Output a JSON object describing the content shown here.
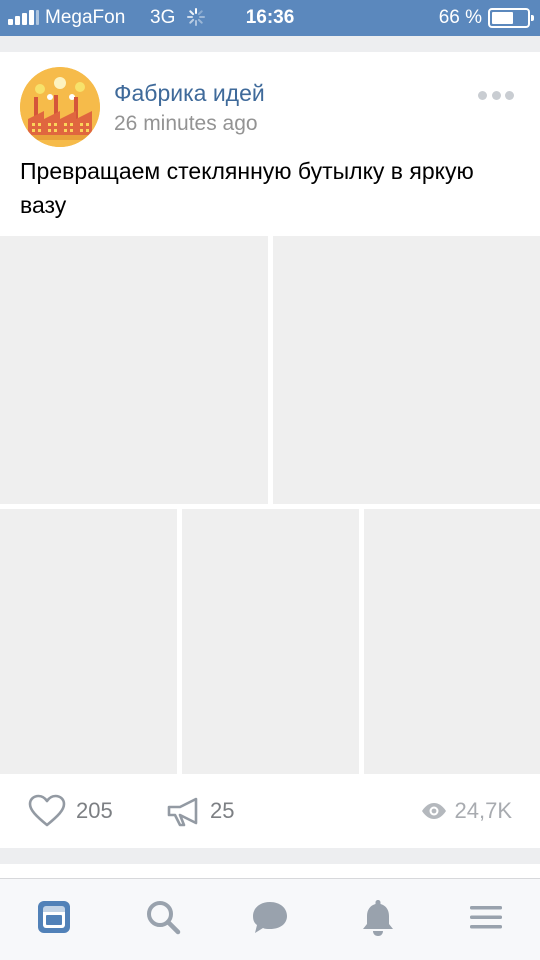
{
  "status_bar": {
    "carrier": "MegaFon",
    "network": "3G",
    "time": "16:36",
    "battery": "66 %",
    "battery_level": 0.66
  },
  "post": {
    "author": "Фабрика идей",
    "time_ago": "26 minutes ago",
    "text": "Превращаем стеклянную бутылку в яркую вазу",
    "photo_count": 5,
    "likes": "205",
    "reposts": "25",
    "views": "24,7K"
  },
  "tab_bar": {
    "tabs": [
      "news-icon",
      "search-icon",
      "messages-icon",
      "notifications-icon",
      "menu-icon"
    ],
    "active_tab": "news-icon",
    "active_color": "#5181b8",
    "inactive_color": "#99a2ad"
  },
  "colors": {
    "header": "#5b88bd",
    "link": "#3f6a9a",
    "placeholder": "#efefef"
  }
}
